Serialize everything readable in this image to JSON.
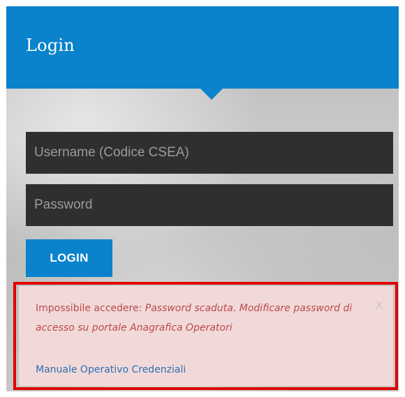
{
  "header": {
    "title": "Login"
  },
  "form": {
    "username_placeholder": "Username (Codice CSEA)",
    "password_placeholder": "Password",
    "login_label": "LOGIN"
  },
  "alert": {
    "prefix": "Impossibile accedere: ",
    "message": "Password scaduta. Modificare password di accesso su portale Anagrafica Operatori",
    "link_label": "Manuale Operativo Credenziali",
    "close_label": "X"
  },
  "colors": {
    "brand_blue": "#0a83cc",
    "field_dark": "#2f2f2f",
    "alert_background": "#f2d9d9",
    "alert_text": "#b94a48",
    "highlight_border": "#e00000",
    "link": "#2c6fb0"
  },
  "icons": {
    "close": "close-icon",
    "header_pointer": "caret-down-icon"
  }
}
